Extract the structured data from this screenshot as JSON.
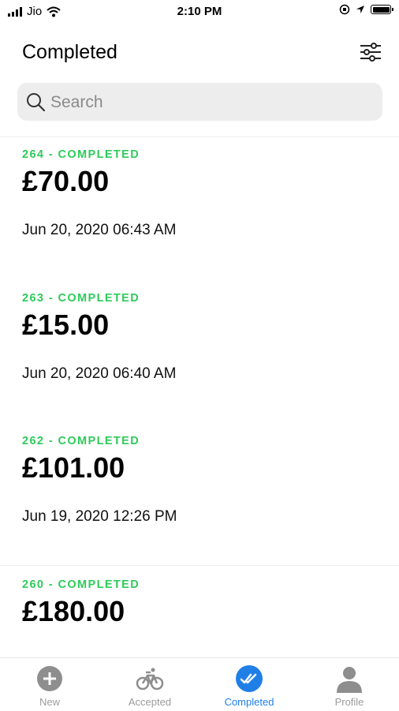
{
  "status_bar": {
    "carrier": "Jio",
    "time": "2:10 PM"
  },
  "header": {
    "title": "Completed"
  },
  "search": {
    "placeholder": "Search"
  },
  "orders": [
    {
      "status": "264 - COMPLETED",
      "amount": "£70.00",
      "date": "Jun 20, 2020 06:43 AM"
    },
    {
      "status": "263 - COMPLETED",
      "amount": "£15.00",
      "date": "Jun 20, 2020 06:40 AM"
    },
    {
      "status": "262 - COMPLETED",
      "amount": "£101.00",
      "date": "Jun 19, 2020 12:26 PM"
    },
    {
      "status": "260 - COMPLETED",
      "amount": "£180.00",
      "date": ""
    }
  ],
  "tabs": [
    {
      "label": "New",
      "icon": "plus-circle-icon"
    },
    {
      "label": "Accepted",
      "icon": "bicycle-icon"
    },
    {
      "label": "Completed",
      "icon": "double-check-icon",
      "active": true
    },
    {
      "label": "Profile",
      "icon": "person-icon"
    }
  ],
  "colors": {
    "accent": "#1f7fe6",
    "completed_green": "#2ecb5b",
    "inactive_tab": "#9b9b9b"
  }
}
